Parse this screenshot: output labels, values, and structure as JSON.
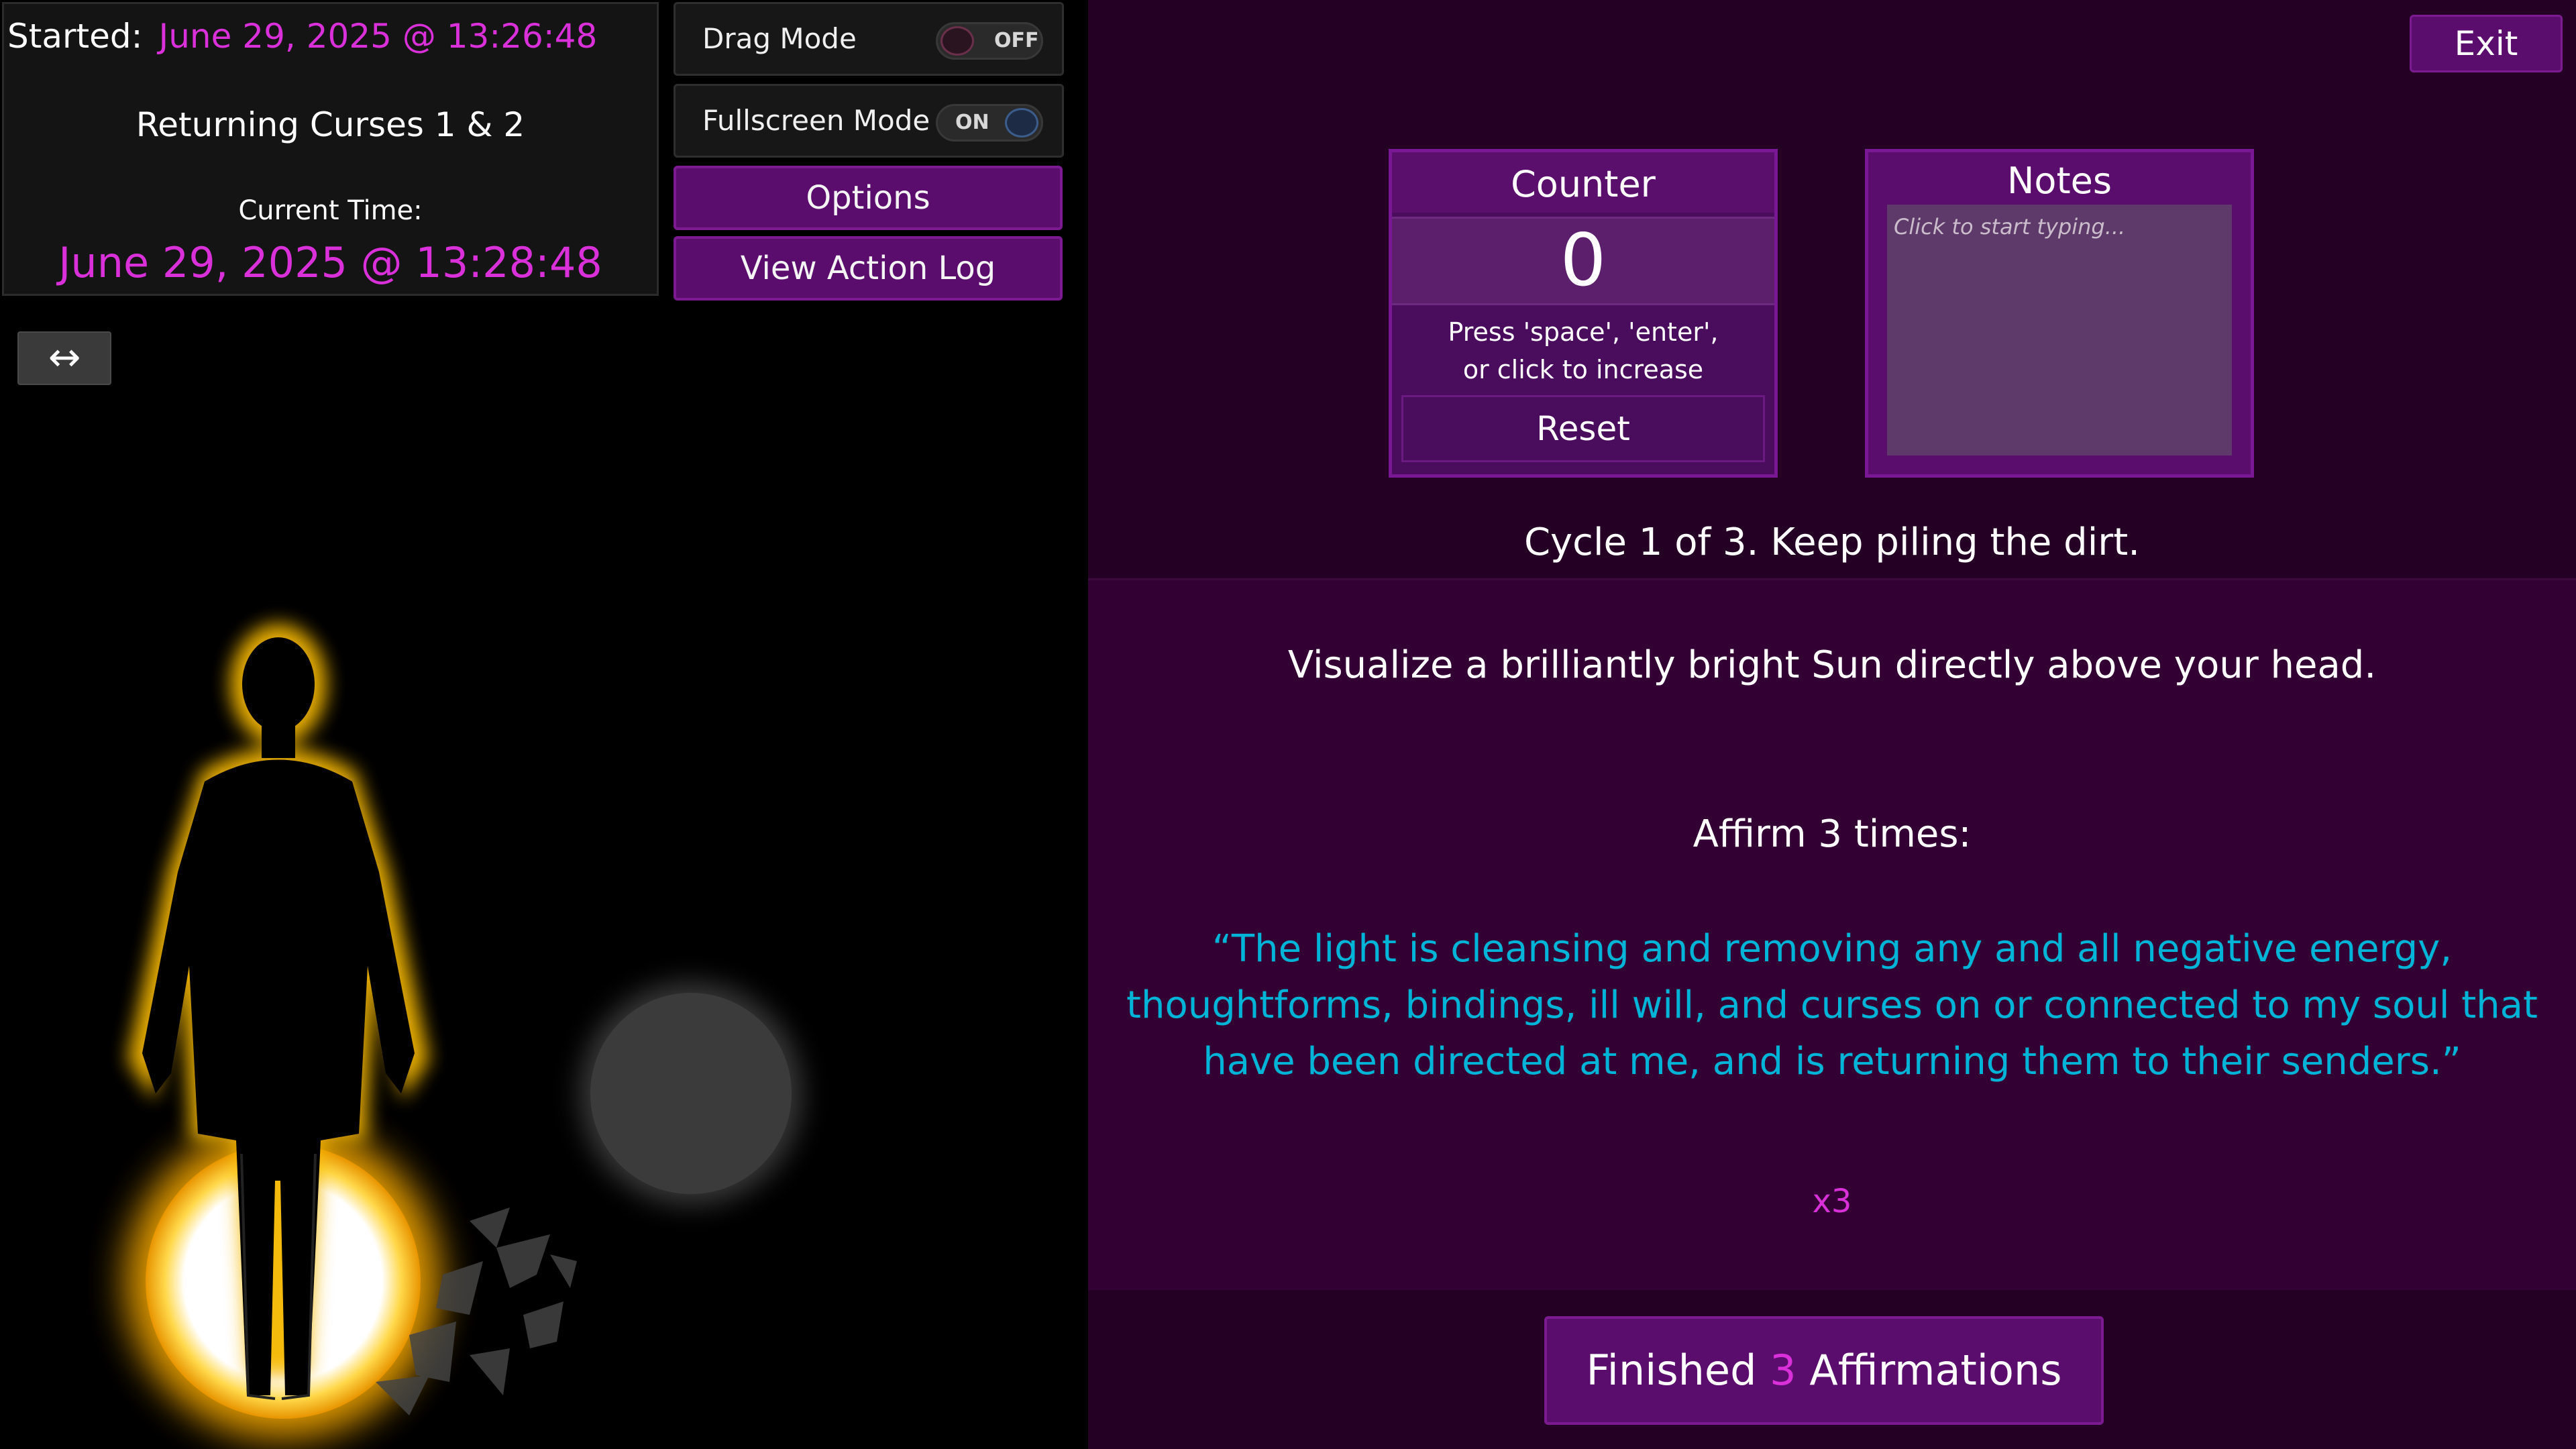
{
  "session": {
    "started_label": "Started:",
    "started_value": "June 29, 2025 @ 13:26:48",
    "title": "Returning Curses 1 & 2",
    "current_time_label": "Current Time:",
    "current_time_value": "June 29, 2025 @ 13:28:48"
  },
  "controls": {
    "drag_mode": {
      "label": "Drag Mode",
      "state": "OFF"
    },
    "fullscreen_mode": {
      "label": "Fullscreen Mode",
      "state": "ON"
    },
    "options_label": "Options",
    "action_log_label": "View Action Log",
    "resize_icon": "↔"
  },
  "exit_label": "Exit",
  "counter": {
    "title": "Counter",
    "value": "0",
    "hint_line1": "Press 'space', 'enter',",
    "hint_line2": "or click to increase",
    "reset_label": "Reset"
  },
  "notes": {
    "title": "Notes",
    "placeholder": "Click to start typing..."
  },
  "cycle_text": "Cycle 1 of 3. Keep piling the dirt.",
  "instruction": {
    "visualize": "Visualize a brilliantly bright Sun directly above your head.",
    "affirm_label": "Affirm 3 times:",
    "affirmation": "“The light is cleansing and removing any and all negative energy, thoughtforms, bindings, ill will, and curses on or connected to my soul that have been directed at me, and is returning them to their senders.”",
    "repeat": "x3"
  },
  "finished_button": {
    "prefix": "Finished",
    "count": "3",
    "suffix": "Affirmations"
  },
  "colors": {
    "accent_magenta": "#d930d9",
    "affirmation_cyan": "#00b4d8",
    "button_purple": "#5b0d6d",
    "panel_purple": "#240024",
    "glow_gold": "#f5b800"
  }
}
